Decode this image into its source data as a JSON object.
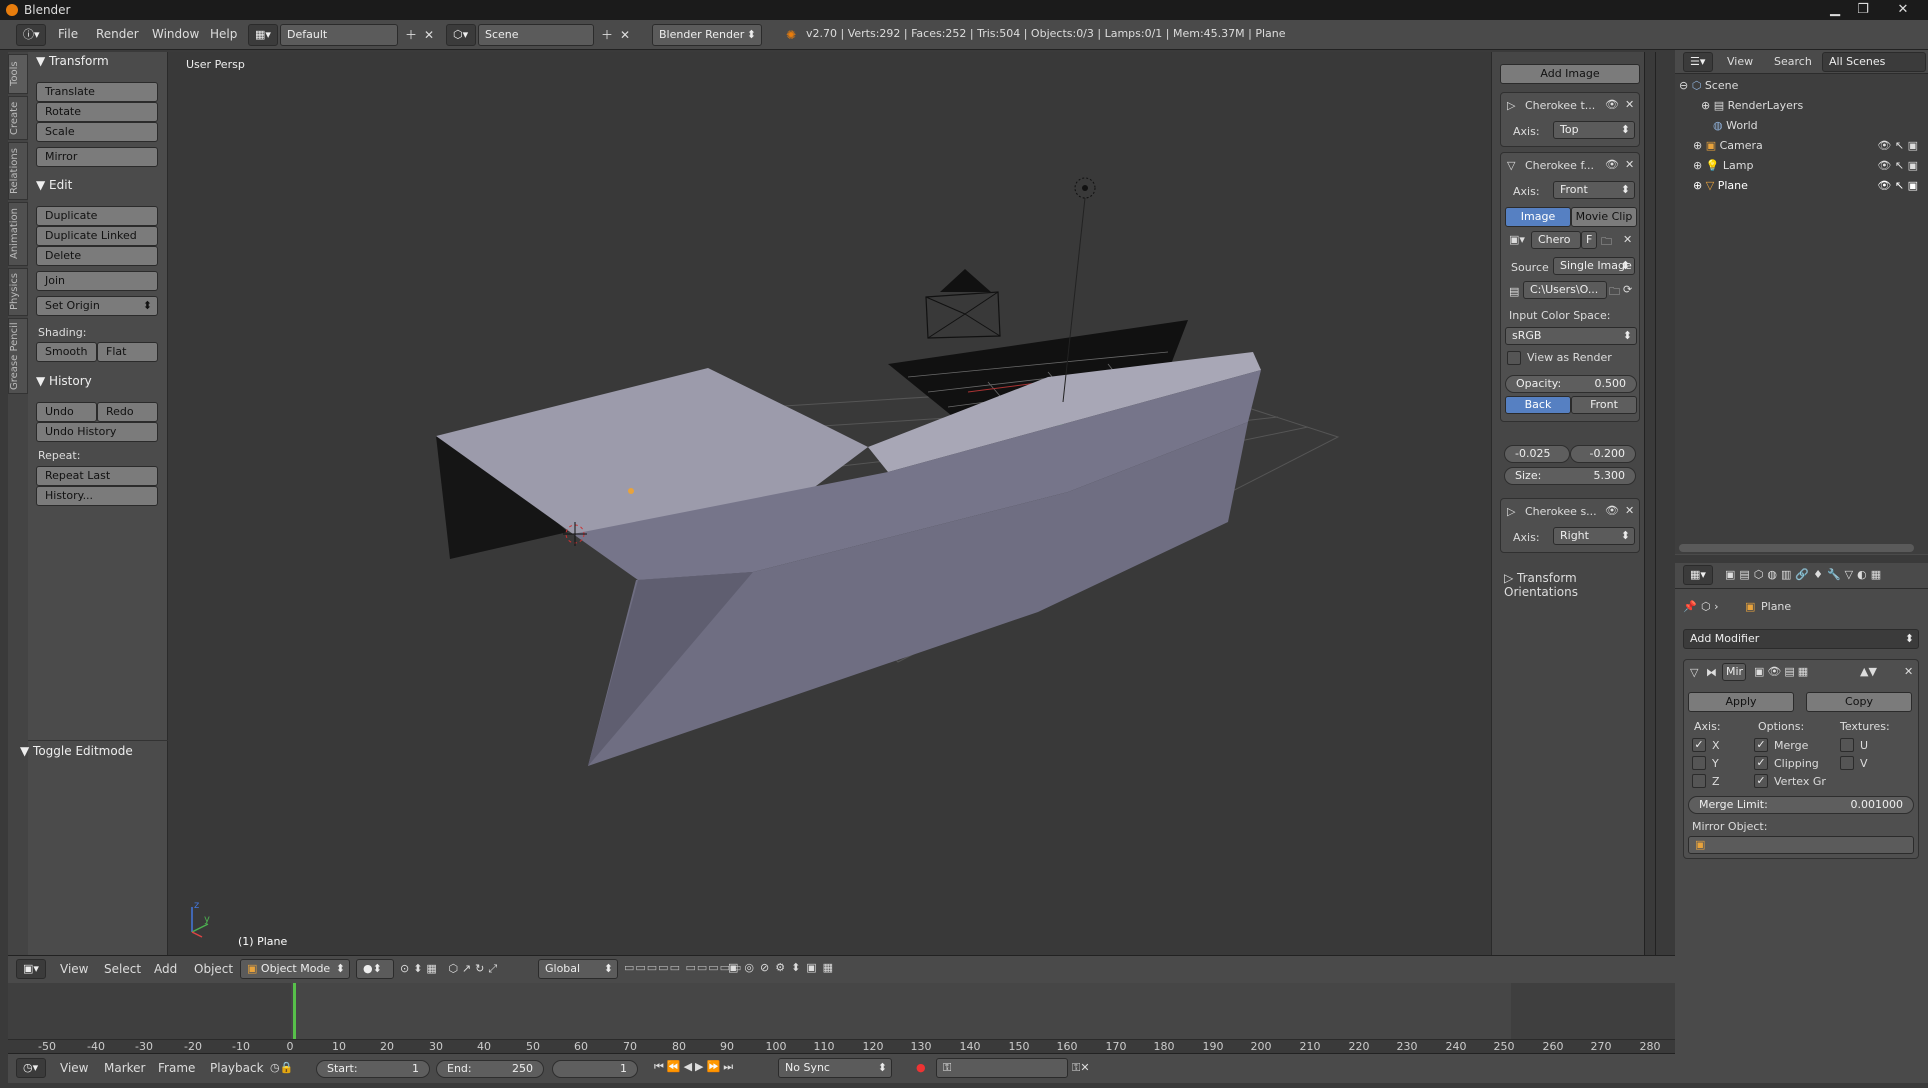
{
  "window": {
    "title": "Blender"
  },
  "topbar": {
    "menus": [
      "File",
      "Render",
      "Window",
      "Help"
    ],
    "screen_layout": "Default",
    "scene": "Scene",
    "engine": "Blender Render",
    "stats": "v2.70 | Verts:292 | Faces:252 | Tris:504 | Objects:0/3 | Lamps:0/1 | Mem:45.37M | Plane"
  },
  "tool_tabs": [
    "Tools",
    "Create",
    "Relations",
    "Animation",
    "Physics",
    "Grease Pencil"
  ],
  "toolshelf": {
    "transform_header": "Transform",
    "translate": "Translate",
    "rotate": "Rotate",
    "scale": "Scale",
    "mirror": "Mirror",
    "edit_header": "Edit",
    "duplicate": "Duplicate",
    "duplicate_linked": "Duplicate Linked",
    "delete": "Delete",
    "join": "Join",
    "set_origin": "Set Origin",
    "shading_label": "Shading:",
    "smooth": "Smooth",
    "flat": "Flat",
    "history_header": "History",
    "undo": "Undo",
    "redo": "Redo",
    "undo_history": "Undo History",
    "repeat_label": "Repeat:",
    "repeat_last": "Repeat Last",
    "history_btn": "History...",
    "toggle_editmode": "Toggle Editmode"
  },
  "viewport": {
    "view_label": "User Persp",
    "object_label": "(1) Plane"
  },
  "npanel": {
    "add_image": "Add Image",
    "bg1": {
      "name": "Cherokee t...",
      "axis_label": "Axis:",
      "axis": "Top"
    },
    "bg2": {
      "name": "Cherokee f...",
      "axis_label": "Axis:",
      "axis": "Front",
      "tab_image": "Image",
      "tab_movie": "Movie Clip",
      "image_name": "Chero",
      "image_f": "F",
      "source_label": "Source",
      "source": "Single Image",
      "path": "C:\\Users\\O...",
      "input_color_label": "Input Color Space:",
      "color_space": "sRGB",
      "view_as_render": "View as Render",
      "opacity_label": "Opacity:",
      "opacity": "0.500",
      "back": "Back",
      "front": "Front",
      "offset_x": "-0.025",
      "offset_y": "-0.200",
      "size_label": "Size:",
      "size": "5.300"
    },
    "bg3": {
      "name": "Cherokee s...",
      "axis_label": "Axis:",
      "axis": "Right"
    },
    "transform_orientations": "Transform Orientations"
  },
  "outliner": {
    "view": "View",
    "search": "Search",
    "filter": "All Scenes",
    "items": [
      "Scene",
      "RenderLayers",
      "World",
      "Camera",
      "Lamp",
      "Plane"
    ]
  },
  "properties": {
    "breadcrumb": "Plane",
    "add_modifier": "Add Modifier",
    "modifier_name": "Mir",
    "apply": "Apply",
    "copy": "Copy",
    "axis_label": "Axis:",
    "options_label": "Options:",
    "textures_label": "Textures:",
    "x": "X",
    "y": "Y",
    "z": "Z",
    "merge": "Merge",
    "clipping": "Clipping",
    "vertex_gr": "Vertex Gr",
    "u": "U",
    "v": "V",
    "merge_limit_label": "Merge Limit:",
    "merge_limit": "0.001000",
    "mirror_object_label": "Mirror Object:"
  },
  "view3d_header": {
    "menus": [
      "View",
      "Select",
      "Add",
      "Object"
    ],
    "mode": "Object Mode",
    "orientation": "Global"
  },
  "timeline": {
    "ticks": [
      "-50",
      "-40",
      "-30",
      "-20",
      "-10",
      "0",
      "10",
      "20",
      "30",
      "40",
      "50",
      "60",
      "70",
      "80",
      "90",
      "100",
      "110",
      "120",
      "130",
      "140",
      "150",
      "160",
      "170",
      "180",
      "190",
      "200",
      "210",
      "220",
      "230",
      "240",
      "250",
      "260",
      "270",
      "280"
    ],
    "menus": [
      "View",
      "Marker",
      "Frame",
      "Playback"
    ],
    "start_label": "Start:",
    "start": "1",
    "end_label": "End:",
    "end": "250",
    "current": "1",
    "sync": "No Sync"
  }
}
